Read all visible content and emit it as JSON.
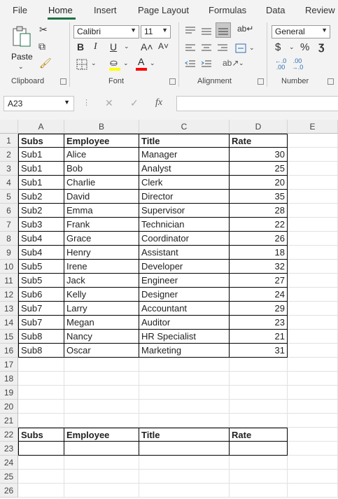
{
  "ribbon_tabs": [
    "File",
    "Home",
    "Insert",
    "Page Layout",
    "Formulas",
    "Data",
    "Review"
  ],
  "ribbon": {
    "paste_label": "Paste",
    "font_name": "Calibri",
    "font_size": "11",
    "number_format": "General",
    "groups": {
      "clipboard": "Clipboard",
      "font": "Font",
      "alignment": "Alignment",
      "number": "Number"
    },
    "bold": "B",
    "italic": "I",
    "underline": "U",
    "grow_font": "A˄",
    "shrink_font": "A˅",
    "currency": "$",
    "percent": "%",
    "comma": "ʒ",
    "inc_decimal": "←.0 .00",
    "dec_decimal": ".00 →.0"
  },
  "formula_bar": {
    "name_box": "A23",
    "fx": "fx",
    "formula": ""
  },
  "columns": [
    "A",
    "B",
    "C",
    "D",
    "E"
  ],
  "rows": [
    [
      "Subs",
      "Employee",
      "Title",
      "Rate"
    ],
    [
      "Sub1",
      "Alice",
      "Manager",
      "30"
    ],
    [
      "Sub1",
      "Bob",
      "Analyst",
      "25"
    ],
    [
      "Sub1",
      "Charlie",
      "Clerk",
      "20"
    ],
    [
      "Sub2",
      "David",
      "Director",
      "35"
    ],
    [
      "Sub2",
      "Emma",
      "Supervisor",
      "28"
    ],
    [
      "Sub3",
      "Frank",
      "Technician",
      "22"
    ],
    [
      "Sub4",
      "Grace",
      "Coordinator",
      "26"
    ],
    [
      "Sub4",
      "Henry",
      "Assistant",
      "18"
    ],
    [
      "Sub5",
      "Irene",
      "Developer",
      "32"
    ],
    [
      "Sub5",
      "Jack",
      "Engineer",
      "27"
    ],
    [
      "Sub6",
      "Kelly",
      "Designer",
      "24"
    ],
    [
      "Sub7",
      "Larry",
      "Accountant",
      "29"
    ],
    [
      "Sub7",
      "Megan",
      "Auditor",
      "23"
    ],
    [
      "Sub8",
      "Nancy",
      "HR Specialist",
      "21"
    ],
    [
      "Sub8",
      "Oscar",
      "Marketing",
      "31"
    ],
    [
      "",
      "",
      "",
      ""
    ],
    [
      "",
      "",
      "",
      ""
    ],
    [
      "",
      "",
      "",
      ""
    ],
    [
      "",
      "",
      "",
      ""
    ],
    [
      "",
      "",
      "",
      ""
    ],
    [
      "Subs",
      "Employee",
      "Title",
      "Rate"
    ],
    [
      "",
      "",
      "",
      ""
    ],
    [
      "",
      "",
      "",
      ""
    ],
    [
      "",
      "",
      "",
      ""
    ],
    [
      "",
      "",
      "",
      ""
    ]
  ],
  "row_numbers": [
    "1",
    "2",
    "3",
    "4",
    "5",
    "6",
    "7",
    "8",
    "9",
    "10",
    "11",
    "12",
    "13",
    "14",
    "15",
    "16",
    "17",
    "18",
    "19",
    "20",
    "21",
    "22",
    "23",
    "24",
    "25",
    "26"
  ],
  "bordered_rows": [
    1,
    2,
    3,
    4,
    5,
    6,
    7,
    8,
    9,
    10,
    11,
    12,
    13,
    14,
    15,
    16,
    22,
    23
  ],
  "header_rows": [
    1,
    22
  ],
  "colors": {
    "accent": "#1e7145",
    "fill_highlight": "#ffff00",
    "font_color": "#ff0000"
  }
}
